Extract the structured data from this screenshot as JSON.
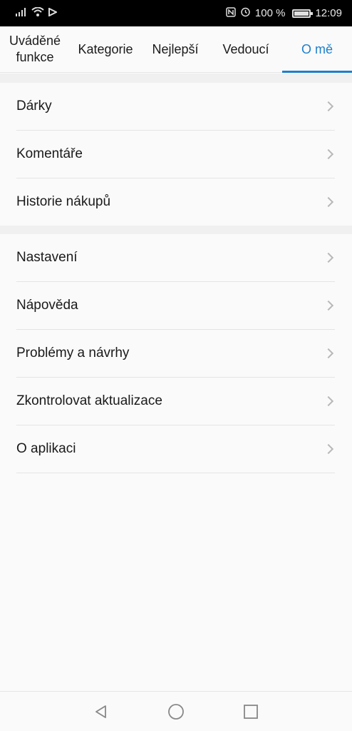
{
  "status_bar": {
    "battery_text": "100 %",
    "time": "12:09"
  },
  "tabs": [
    {
      "label": "Uváděné funkce"
    },
    {
      "label": "Kategorie"
    },
    {
      "label": "Nejlepší"
    },
    {
      "label": "Vedoucí"
    },
    {
      "label": "O mě",
      "active": true
    }
  ],
  "menu_group_1": [
    {
      "label": "Dárky"
    },
    {
      "label": "Komentáře"
    },
    {
      "label": "Historie nákupů"
    }
  ],
  "menu_group_2": [
    {
      "label": "Nastavení"
    },
    {
      "label": "Nápověda"
    },
    {
      "label": "Problémy a návrhy"
    },
    {
      "label": "Zkontrolovat aktualizace"
    },
    {
      "label": "O aplikaci"
    }
  ],
  "colors": {
    "accent": "#1e7fcb",
    "text": "#1a1a1a",
    "chevron": "#b8b8b8"
  },
  "icons": [
    "signal-icon",
    "wifi-icon",
    "data-icon",
    "nfc-icon",
    "alarm-icon",
    "battery-icon",
    "back-icon",
    "home-icon",
    "recents-icon",
    "chevron-right-icon"
  ]
}
